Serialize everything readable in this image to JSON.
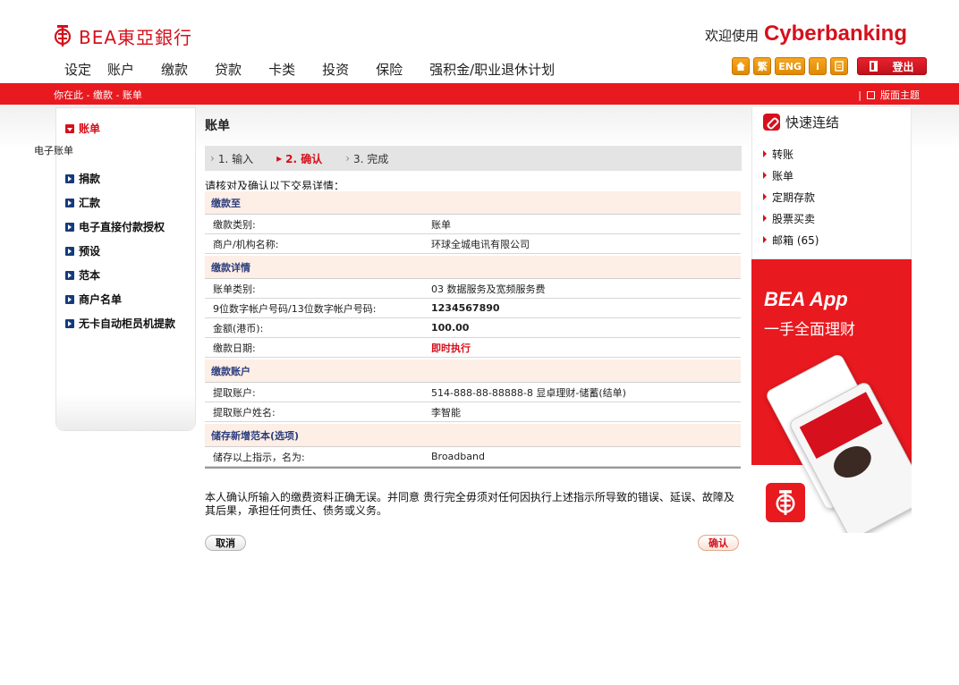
{
  "brand": {
    "logo_text": "BEA東亞銀行",
    "welcome_prefix": "欢迎使用",
    "welcome_brand": "Cyberbanking"
  },
  "topnav": [
    "设定",
    "账户",
    "缴款",
    "贷款",
    "卡类",
    "投资",
    "保险",
    "强积金/职业退休计划"
  ],
  "util": {
    "trad": "繁",
    "eng": "ENG",
    "info": "i",
    "logout": "登出"
  },
  "breadcrumb": "你在此 - 缴款  - 账单",
  "theme_label": "版面主题",
  "leftnav": {
    "items": [
      "账单",
      "捐款",
      "汇款",
      "电子直接付款授权",
      "预设",
      "范本",
      "商户名单",
      "无卡自动柜员机提款"
    ],
    "sub_item": "电子账单"
  },
  "page": {
    "title": "账单",
    "steps": [
      {
        "label": "1. 输入",
        "current": false
      },
      {
        "label": "2. 确认",
        "current": true
      },
      {
        "label": "3. 完成",
        "current": false
      }
    ],
    "instruction": "请核对及确认以下交易详情：",
    "sections": [
      {
        "title": "缴款至",
        "rows": [
          {
            "key": "缴款类别:",
            "value": "账单"
          },
          {
            "key": "商户/机构名称:",
            "value": "环球全城电讯有限公司"
          }
        ]
      },
      {
        "title": "缴款详情",
        "rows": [
          {
            "key": "账单类别:",
            "value": "03  数据服务及宽频服务费"
          },
          {
            "key": "9位数字帐户号码/13位数字帐户号码:",
            "value": "1234567890"
          },
          {
            "key": "金额(港币):",
            "value": "100.00"
          },
          {
            "key": "缴款日期:",
            "value": "即时执行"
          }
        ]
      },
      {
        "title": "缴款账户",
        "rows": [
          {
            "key": "提取账户:",
            "value": "514-888-88-88888-8 显卓理财-储蓄(结单)"
          },
          {
            "key": "提取账户姓名:",
            "value": "李智能"
          }
        ]
      },
      {
        "title": "储存新增范本(选项)",
        "rows": [
          {
            "key": "储存以上指示，名为:",
            "value": "Broadband"
          }
        ]
      }
    ],
    "disclaimer": "本人确认所输入的缴费资料正确无误。并同意 贵行完全毋须对任何因执行上述指示所导致的错误、延误、故障及其后果，承担任何责任、债务或义务。",
    "cancel_label": "取消",
    "confirm_label": "确认"
  },
  "quick_links": {
    "title": "快速连结",
    "items": [
      "转账",
      "账单",
      "定期存款",
      "股票买卖",
      "邮箱 (65)"
    ]
  },
  "promo": {
    "title": "BEA App",
    "subtitle": "一手全面理财"
  },
  "colors": {
    "brand_red": "#e8191f",
    "nav_blue": "#153b7d",
    "section_bg": "#fdeee6"
  }
}
